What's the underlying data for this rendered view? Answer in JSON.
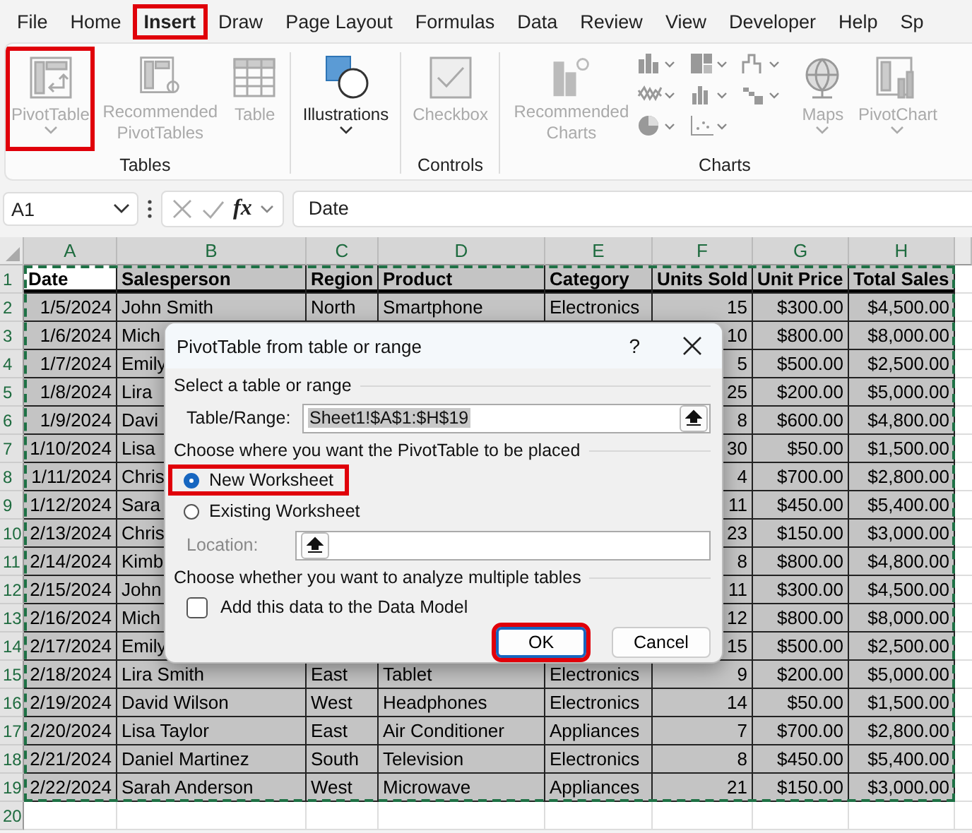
{
  "menu_tabs": [
    {
      "label": "File",
      "selected": false,
      "highlighted": false
    },
    {
      "label": "Home",
      "selected": false,
      "highlighted": false
    },
    {
      "label": "Insert",
      "selected": true,
      "highlighted": true
    },
    {
      "label": "Draw",
      "selected": false,
      "highlighted": false
    },
    {
      "label": "Page Layout",
      "selected": false,
      "highlighted": false
    },
    {
      "label": "Formulas",
      "selected": false,
      "highlighted": false
    },
    {
      "label": "Data",
      "selected": false,
      "highlighted": false
    },
    {
      "label": "Review",
      "selected": false,
      "highlighted": false
    },
    {
      "label": "View",
      "selected": false,
      "highlighted": false
    },
    {
      "label": "Developer",
      "selected": false,
      "highlighted": false
    },
    {
      "label": "Help",
      "selected": false,
      "highlighted": false
    },
    {
      "label": "Sp",
      "selected": false,
      "highlighted": false
    }
  ],
  "ribbon_groups": [
    {
      "label": "Tables",
      "buttons": [
        {
          "kind": "pivot",
          "label": "PivotTable",
          "disabled": true,
          "dropdown": true,
          "highlighted": true
        },
        {
          "kind": "recommend",
          "label": "Recommended PivotTables",
          "disabled": true,
          "dropdown": false,
          "highlighted": false
        },
        {
          "kind": "grid",
          "label": "Table",
          "disabled": true,
          "dropdown": false,
          "highlighted": false
        }
      ]
    },
    {
      "buttons": [
        {
          "kind": "shapes",
          "label": "Illustrations",
          "disabled": false,
          "dropdown": true,
          "highlighted": false
        }
      ]
    },
    {
      "label": "Controls",
      "buttons": [
        {
          "kind": "checkbox",
          "label": "Checkbox",
          "disabled": true,
          "dropdown": false,
          "highlighted": false
        }
      ]
    },
    {
      "label": "Charts",
      "buttons": [
        {
          "kind": "charts",
          "label": "Recommended Charts",
          "disabled": true,
          "dropdown": false,
          "highlighted": false
        },
        {
          "kind": "gallery"
        },
        {
          "kind": "globe",
          "label": "Maps",
          "disabled": true,
          "dropdown": true,
          "highlighted": false
        },
        {
          "kind": "pivotchart",
          "label": "PivotChart",
          "disabled": true,
          "dropdown": true,
          "highlighted": false
        }
      ]
    }
  ],
  "formula_bar": {
    "name_box": "A1",
    "function_label": "fx",
    "formula": "Date"
  },
  "sheet": {
    "columns": [
      "A",
      "B",
      "C",
      "D",
      "E",
      "F",
      "G",
      "H"
    ],
    "rows": [
      {
        "number": "1",
        "selected": true,
        "header": true,
        "cells": {
          "a": "Date",
          "b": "Salesperson",
          "c": "Region",
          "d": "Product",
          "e": "Category",
          "f": "Units Sold",
          "g": "Unit Price",
          "h": "Total Sales"
        }
      },
      {
        "number": "2",
        "selected": true,
        "header": false,
        "cells": {
          "a": "1/5/2024",
          "b": "John Smith",
          "c": "North",
          "d": "Smartphone",
          "e": "Electronics",
          "f": "15",
          "g": "$300.00",
          "h": "$4,500.00"
        }
      },
      {
        "number": "3",
        "selected": true,
        "header": false,
        "cells": {
          "a": "1/6/2024",
          "b": "Mich",
          "f": "10",
          "g": "$800.00",
          "h": "$8,000.00"
        }
      },
      {
        "number": "4",
        "selected": true,
        "header": false,
        "cells": {
          "a": "1/7/2024",
          "b": "Emily",
          "f": "5",
          "g": "$500.00",
          "h": "$2,500.00"
        }
      },
      {
        "number": "5",
        "selected": true,
        "header": false,
        "cells": {
          "a": "1/8/2024",
          "b": "Lira",
          "f": "25",
          "g": "$200.00",
          "h": "$5,000.00"
        }
      },
      {
        "number": "6",
        "selected": true,
        "header": false,
        "cells": {
          "a": "1/9/2024",
          "b": "Davi",
          "f": "8",
          "g": "$600.00",
          "h": "$4,800.00"
        }
      },
      {
        "number": "7",
        "selected": true,
        "header": false,
        "cells": {
          "a": "1/10/2024",
          "b": "Lisa",
          "f": "30",
          "g": "$50.00",
          "h": "$1,500.00"
        }
      },
      {
        "number": "8",
        "selected": true,
        "header": false,
        "cells": {
          "a": "1/11/2024",
          "b": "Chris",
          "f": "4",
          "g": "$700.00",
          "h": "$2,800.00"
        }
      },
      {
        "number": "9",
        "selected": true,
        "header": false,
        "cells": {
          "a": "1/12/2024",
          "b": "Sara",
          "f": "11",
          "g": "$450.00",
          "h": "$5,400.00"
        }
      },
      {
        "number": "10",
        "selected": true,
        "header": false,
        "cells": {
          "a": "2/13/2024",
          "b": "Chris",
          "f": "23",
          "g": "$150.00",
          "h": "$3,000.00"
        }
      },
      {
        "number": "11",
        "selected": true,
        "header": false,
        "cells": {
          "a": "2/14/2024",
          "b": "Kimb",
          "f": "8",
          "g": "$800.00",
          "h": "$4,800.00"
        }
      },
      {
        "number": "12",
        "selected": true,
        "header": false,
        "cells": {
          "a": "2/15/2024",
          "b": "John",
          "f": "11",
          "g": "$300.00",
          "h": "$4,500.00"
        }
      },
      {
        "number": "13",
        "selected": true,
        "header": false,
        "cells": {
          "a": "2/16/2024",
          "b": "Mich",
          "f": "12",
          "g": "$800.00",
          "h": "$8,000.00"
        }
      },
      {
        "number": "14",
        "selected": true,
        "header": false,
        "cells": {
          "a": "2/17/2024",
          "b": "Emily",
          "f": "15",
          "g": "$500.00",
          "h": "$2,500.00"
        }
      },
      {
        "number": "15",
        "selected": true,
        "header": false,
        "cells": {
          "a": "2/18/2024",
          "b": "Lira Smith",
          "c": "East",
          "d": "Tablet",
          "e": "Electronics",
          "f": "9",
          "g": "$200.00",
          "h": "$5,000.00"
        }
      },
      {
        "number": "16",
        "selected": true,
        "header": false,
        "cells": {
          "a": "2/19/2024",
          "b": "David Wilson",
          "c": "West",
          "d": "Headphones",
          "e": "Electronics",
          "f": "14",
          "g": "$50.00",
          "h": "$1,500.00"
        }
      },
      {
        "number": "17",
        "selected": true,
        "header": false,
        "cells": {
          "a": "2/20/2024",
          "b": "Lisa Taylor",
          "c": "East",
          "d": "Air Conditioner",
          "e": "Appliances",
          "f": "7",
          "g": "$700.00",
          "h": "$2,800.00"
        }
      },
      {
        "number": "18",
        "selected": true,
        "header": false,
        "cells": {
          "a": "2/21/2024",
          "b": "Daniel Martinez",
          "c": "South",
          "d": "Television",
          "e": "Electronics",
          "f": "8",
          "g": "$450.00",
          "h": "$5,400.00"
        }
      },
      {
        "number": "19",
        "selected": true,
        "header": false,
        "cells": {
          "a": "2/22/2024",
          "b": "Sarah Anderson",
          "c": "West",
          "d": "Microwave",
          "e": "Appliances",
          "f": "21",
          "g": "$150.00",
          "h": "$3,000.00"
        }
      },
      {
        "number": "20",
        "selected": false,
        "header": false,
        "cells": {}
      }
    ]
  },
  "dialog": {
    "title": "PivotTable from table or range",
    "help": "?",
    "section_source": "Select a table or range",
    "range_label": "Table/Range:",
    "range_value": "Sheet1!$A$1:$H$19",
    "section_place": "Choose where you want the PivotTable to be placed",
    "placements": [
      {
        "label": "New Worksheet",
        "selected": true,
        "highlighted": true
      },
      {
        "label": "Existing Worksheet",
        "selected": false,
        "highlighted": false
      }
    ],
    "location_label": "Location:",
    "location_disabled": true,
    "section_multi": "Choose whether you want to analyze multiple tables",
    "data_model": {
      "label": "Add this data to the Data Model",
      "checked": false
    },
    "buttons": [
      {
        "label": "OK",
        "default": true,
        "highlighted": true
      },
      {
        "label": "Cancel",
        "default": false,
        "highlighted": false
      }
    ]
  }
}
